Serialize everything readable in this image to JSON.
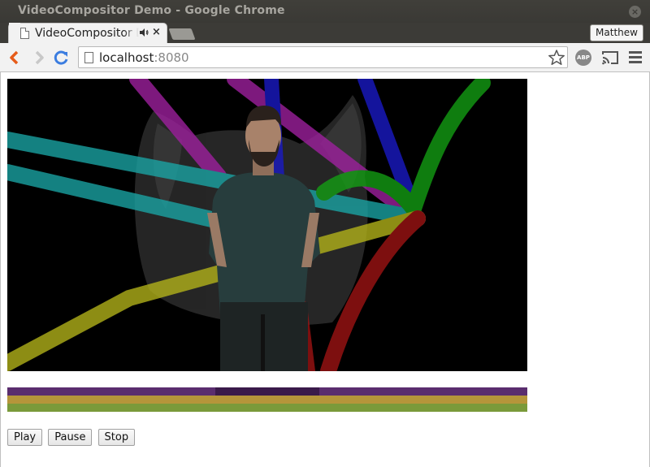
{
  "window": {
    "title": "VideoCompositor Demo - Google Chrome",
    "close_glyph": "×"
  },
  "tab": {
    "title": "VideoCompositor Demo",
    "close_glyph": "×",
    "icons": [
      "page-icon",
      "speaker-icon",
      "close-icon"
    ]
  },
  "profile": {
    "name": "Matthew"
  },
  "toolbar": {
    "url_host": "localhost",
    "url_port": ":8080",
    "extension_label": "ABP",
    "icons": [
      "back-arrow-icon",
      "forward-arrow-icon",
      "reload-icon",
      "page-icon",
      "star-icon",
      "adblock-icon",
      "cast-icon",
      "menu-icon"
    ]
  },
  "colors": {
    "back_arrow": "#e65c1a",
    "reload": "#3b7de0",
    "track_purple": "#5a2d6e",
    "track_purple_active": "#3a1a4a",
    "track_gold": "#b5953a",
    "track_olive": "#7a9a3a"
  },
  "controls": {
    "play_label": "Play",
    "pause_label": "Pause",
    "stop_label": "Stop"
  }
}
